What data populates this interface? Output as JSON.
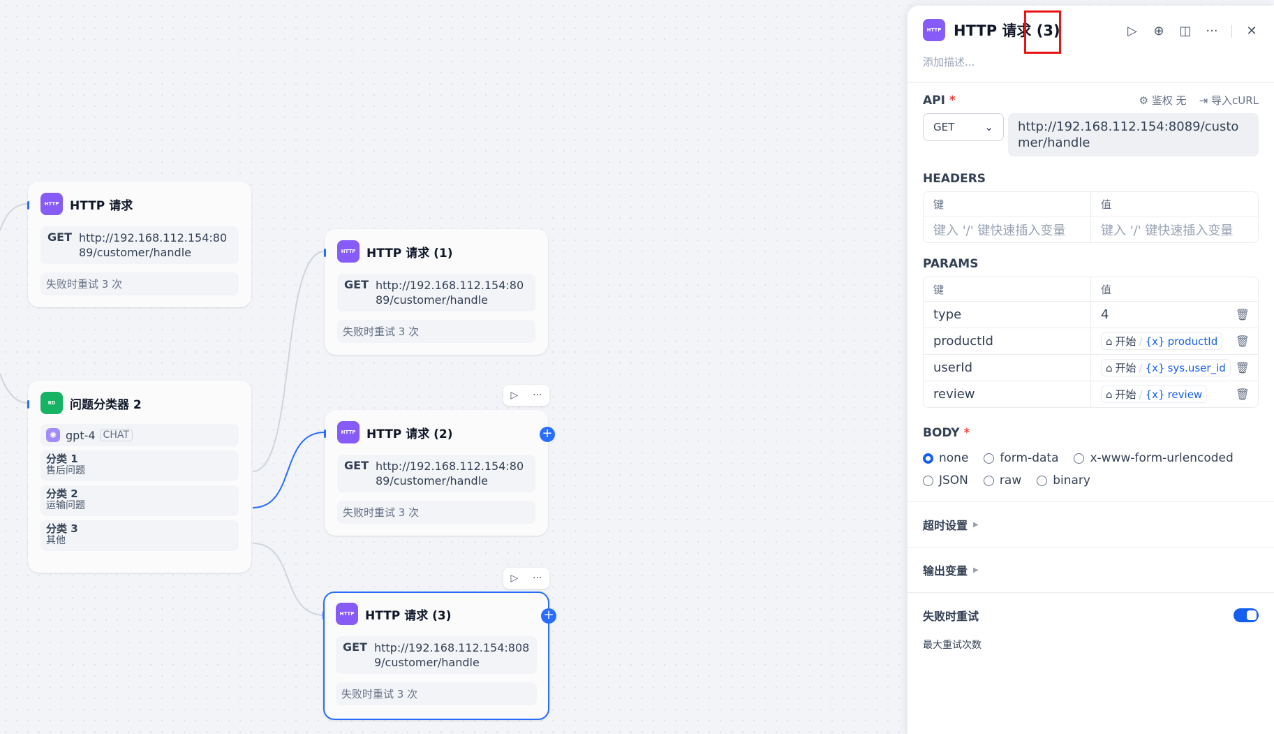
{
  "canvas": {
    "nodes": {
      "http_main": {
        "title": "HTTP 请求",
        "method": "GET",
        "url": "http://192.168.112.154:8089/customer/handle",
        "retry": "失败时重试 3 次"
      },
      "http_1": {
        "title": "HTTP 请求 (1)",
        "method": "GET",
        "url": "http://192.168.112.154:8089/customer/handle",
        "retry": "失败时重试 3 次"
      },
      "http_2": {
        "title": "HTTP 请求 (2)",
        "method": "GET",
        "url": "http://192.168.112.154:8089/customer/handle",
        "retry": "失败时重试 3 次"
      },
      "http_3": {
        "title": "HTTP 请求 (3)",
        "method": "GET",
        "url": "http://192.168.112.154:8089/customer/handle",
        "retry": "失败时重试 3 次"
      },
      "classifier": {
        "title": "问题分类器 2",
        "model": "gpt-4",
        "model_badge": "CHAT",
        "classes": [
          {
            "title": "分类 1",
            "sub": "售后问题"
          },
          {
            "title": "分类 2",
            "sub": "运输问题"
          },
          {
            "title": "分类 3",
            "sub": "其他"
          }
        ]
      }
    },
    "http_icon_text": "HTTP",
    "plus_symbol": "+",
    "toolbar": {
      "run_symbol": "▷",
      "more_symbol": "···"
    }
  },
  "panel": {
    "title": "HTTP 请求",
    "title_suffix": "(3)",
    "description_placeholder": "添加描述...",
    "api": {
      "label": "API",
      "required_mark": "*",
      "auth_label": "鉴权 无",
      "import_label": "导入cURL",
      "method": "GET",
      "url": "http://192.168.112.154:8089/customer/handle"
    },
    "headers": {
      "label": "HEADERS",
      "key_header": "键",
      "value_header": "值",
      "key_placeholder": "键入 '/' 键快速插入变量",
      "value_placeholder": "键入 '/' 键快速插入变量"
    },
    "params": {
      "label": "PARAMS",
      "key_header": "键",
      "value_header": "值",
      "rows": [
        {
          "key": "type",
          "value": "4"
        },
        {
          "key": "productId",
          "node": "开始",
          "var": "productId"
        },
        {
          "key": "userId",
          "node": "开始",
          "var": "sys.user_id"
        },
        {
          "key": "review",
          "node": "开始",
          "var": "review"
        }
      ]
    },
    "body": {
      "label": "BODY",
      "required_mark": "*",
      "options": [
        "none",
        "form-data",
        "x-www-form-urlencoded",
        "JSON",
        "raw",
        "binary"
      ],
      "selected": "none"
    },
    "timeout_label": "超时设置",
    "output_label": "输出变量",
    "retry_label": "失败时重试",
    "retry_enabled": true,
    "max_retry_label": "最大重试次数",
    "accent_color": "#155eef",
    "highlight_color": "#e81313"
  }
}
